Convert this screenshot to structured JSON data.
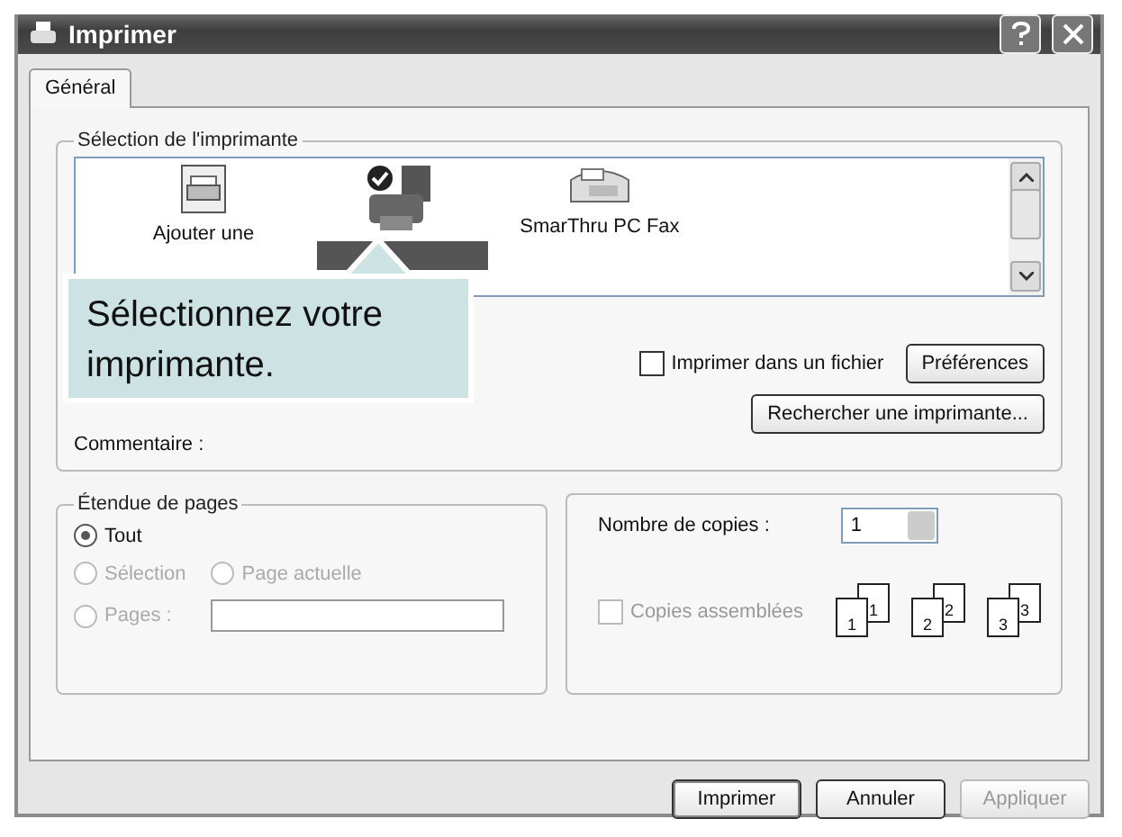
{
  "window": {
    "title": "Imprimer"
  },
  "tabs": [
    {
      "label": "Général",
      "selected": true
    }
  ],
  "printer_group": {
    "title": "Sélection de l'imprimante",
    "printers": [
      {
        "kind": "add",
        "label": "Ajouter une",
        "selected": false
      },
      {
        "kind": "printer",
        "selected": true
      },
      {
        "kind": "fax",
        "label": "SmarThru PC Fax",
        "selected": false
      }
    ],
    "print_to_file": {
      "label": "Imprimer dans un fichier",
      "checked": false
    },
    "preferences_button": "Préférences",
    "find_button": "Rechercher une imprimante...",
    "comment_label": "Commentaire :"
  },
  "callout": {
    "text": "Sélectionnez votre imprimante."
  },
  "range_group": {
    "title": "Étendue de pages",
    "options": [
      {
        "label": "Tout",
        "selected": true,
        "disabled": false
      },
      {
        "label": "Sélection",
        "selected": false,
        "disabled": true
      },
      {
        "label": "Page actuelle",
        "selected": false,
        "disabled": true
      },
      {
        "label": "Pages :",
        "selected": false,
        "disabled": true
      }
    ]
  },
  "copies": {
    "label": "Nombre de copies :",
    "value": "1",
    "collate": {
      "label": "Copies assemblées",
      "checked": false,
      "disabled": true
    },
    "collate_sets": [
      {
        "front": "1",
        "back": "1"
      },
      {
        "front": "2",
        "back": "2"
      },
      {
        "front": "3",
        "back": "3"
      }
    ]
  },
  "buttons": [
    {
      "label": "Imprimer",
      "disabled": false,
      "default": true
    },
    {
      "label": "Annuler",
      "disabled": false,
      "default": false
    },
    {
      "label": "Appliquer",
      "disabled": true,
      "default": false
    }
  ]
}
